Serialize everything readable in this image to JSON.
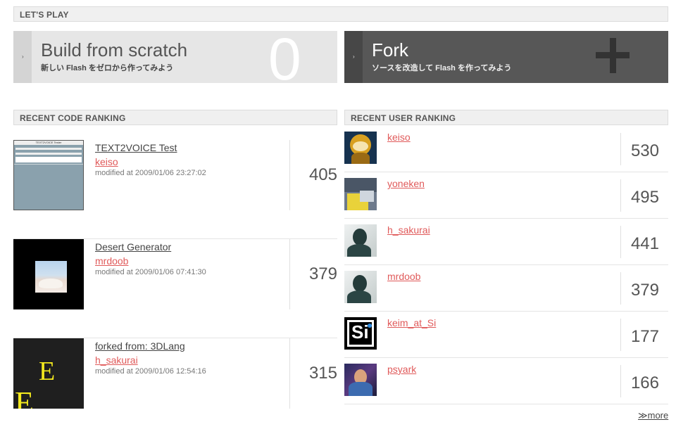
{
  "lets_play": {
    "heading": "LET'S PLAY",
    "build": {
      "title": "Build from scratch",
      "subtitle": "新しい Flash をゼロから作ってみよう",
      "big_glyph": "0",
      "tab_glyph": "›"
    },
    "fork": {
      "title": "Fork",
      "subtitle": "ソースを改造して Flash を作ってみよう",
      "tab_glyph": "›"
    }
  },
  "code_ranking": {
    "heading": "RECENT CODE RANKING",
    "items": [
      {
        "title": "TEXT2VOICE Test",
        "user": "keiso",
        "modified": "modified at 2009/01/06 23:27:02",
        "score": "405",
        "thumb_caption": "TEXT2VOICE Tester"
      },
      {
        "title": "Desert Generator",
        "user": "mrdoob",
        "modified": "modified at 2009/01/06 07:41:30",
        "score": "379"
      },
      {
        "title": "forked from: 3DLang",
        "user": "h_sakurai",
        "modified": "modified at 2009/01/06 12:54:16",
        "score": "315"
      }
    ]
  },
  "user_ranking": {
    "heading": "RECENT USER RANKING",
    "items": [
      {
        "name": "keiso",
        "score": "530"
      },
      {
        "name": "yoneken",
        "score": "495"
      },
      {
        "name": "h_sakurai",
        "score": "441"
      },
      {
        "name": "mrdoob",
        "score": "379"
      },
      {
        "name": "keim_at_Si",
        "score": "177"
      },
      {
        "name": "psyark",
        "score": "166"
      }
    ],
    "more_label": "≫more"
  },
  "colors": {
    "link_red": "#e05a5a",
    "fork_bg": "#575757",
    "build_bg": "#e6e6e6"
  }
}
